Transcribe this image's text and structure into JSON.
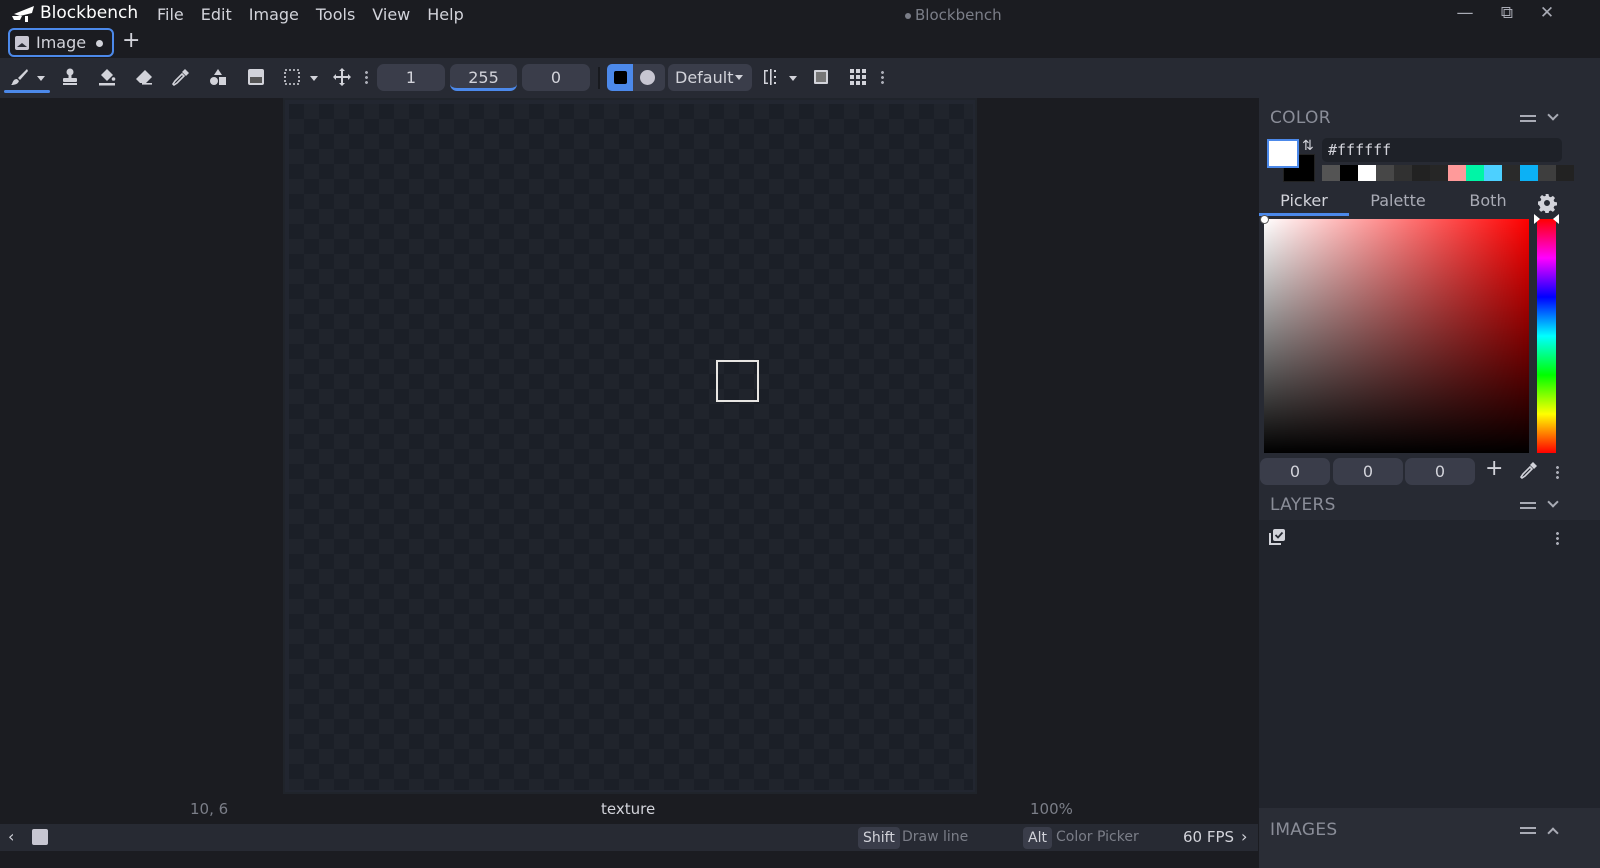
{
  "app": {
    "name": "Blockbench",
    "window_title": "Blockbench",
    "window_modified": true
  },
  "menu": [
    "File",
    "Edit",
    "Image",
    "Tools",
    "View",
    "Help"
  ],
  "window_controls": [
    "minimize",
    "restore",
    "close"
  ],
  "tabs": [
    {
      "label": "Image",
      "icon": "image-icon",
      "modified": true,
      "active": true
    }
  ],
  "new_tab_label": "+",
  "toolbar": {
    "tools": [
      {
        "name": "brush",
        "icon": "paintbrush-icon",
        "active": true,
        "has_dropdown": true
      },
      {
        "name": "clone-stamp",
        "icon": "stamp-icon"
      },
      {
        "name": "fill",
        "icon": "paint-bucket-icon"
      },
      {
        "name": "eraser",
        "icon": "eraser-icon"
      },
      {
        "name": "color-picker",
        "icon": "eyedropper-icon"
      },
      {
        "name": "shapes",
        "icon": "shapes-icon"
      },
      {
        "name": "gradient",
        "icon": "gradient-icon"
      },
      {
        "name": "selection",
        "icon": "selection-icon",
        "has_dropdown": true
      },
      {
        "name": "move",
        "icon": "move-icon"
      }
    ],
    "brush_size": "1",
    "opacity": "255",
    "softness": "0",
    "brush_shape": "square",
    "blend_mode": "Default",
    "extra_icons": [
      "mirror-icon",
      "checkerboard-icon",
      "grid-icon"
    ]
  },
  "canvas": {
    "cursor_position": "10, 6",
    "texture_name": "texture",
    "zoom": "100%"
  },
  "statusbar": {
    "shortcuts": [
      {
        "key": "Shift",
        "action": "Draw line"
      },
      {
        "key": "Alt",
        "action": "Color Picker"
      }
    ],
    "fps": "60 FPS"
  },
  "color_panel": {
    "title": "COLOR",
    "primary_color": "#ffffff",
    "secondary_color": "#000000",
    "hex_value": "#ffffff",
    "swatches": [
      "#545454",
      "#000000",
      "#ffffff",
      "#474747",
      "#313131",
      "#222222",
      "#262626",
      "#ff9a9a",
      "#00f5a6",
      "#4dd0ff",
      "#2a2a2a",
      "#0cb1f5",
      "#3e3e3e",
      "#222222"
    ],
    "tabs": [
      "Picker",
      "Palette",
      "Both"
    ],
    "active_tab": "Picker",
    "rgb": {
      "r": "0",
      "g": "0",
      "b": "0"
    },
    "hue_color": "#ff0000"
  },
  "layers_panel": {
    "title": "LAYERS"
  },
  "images_panel": {
    "title": "IMAGES"
  }
}
